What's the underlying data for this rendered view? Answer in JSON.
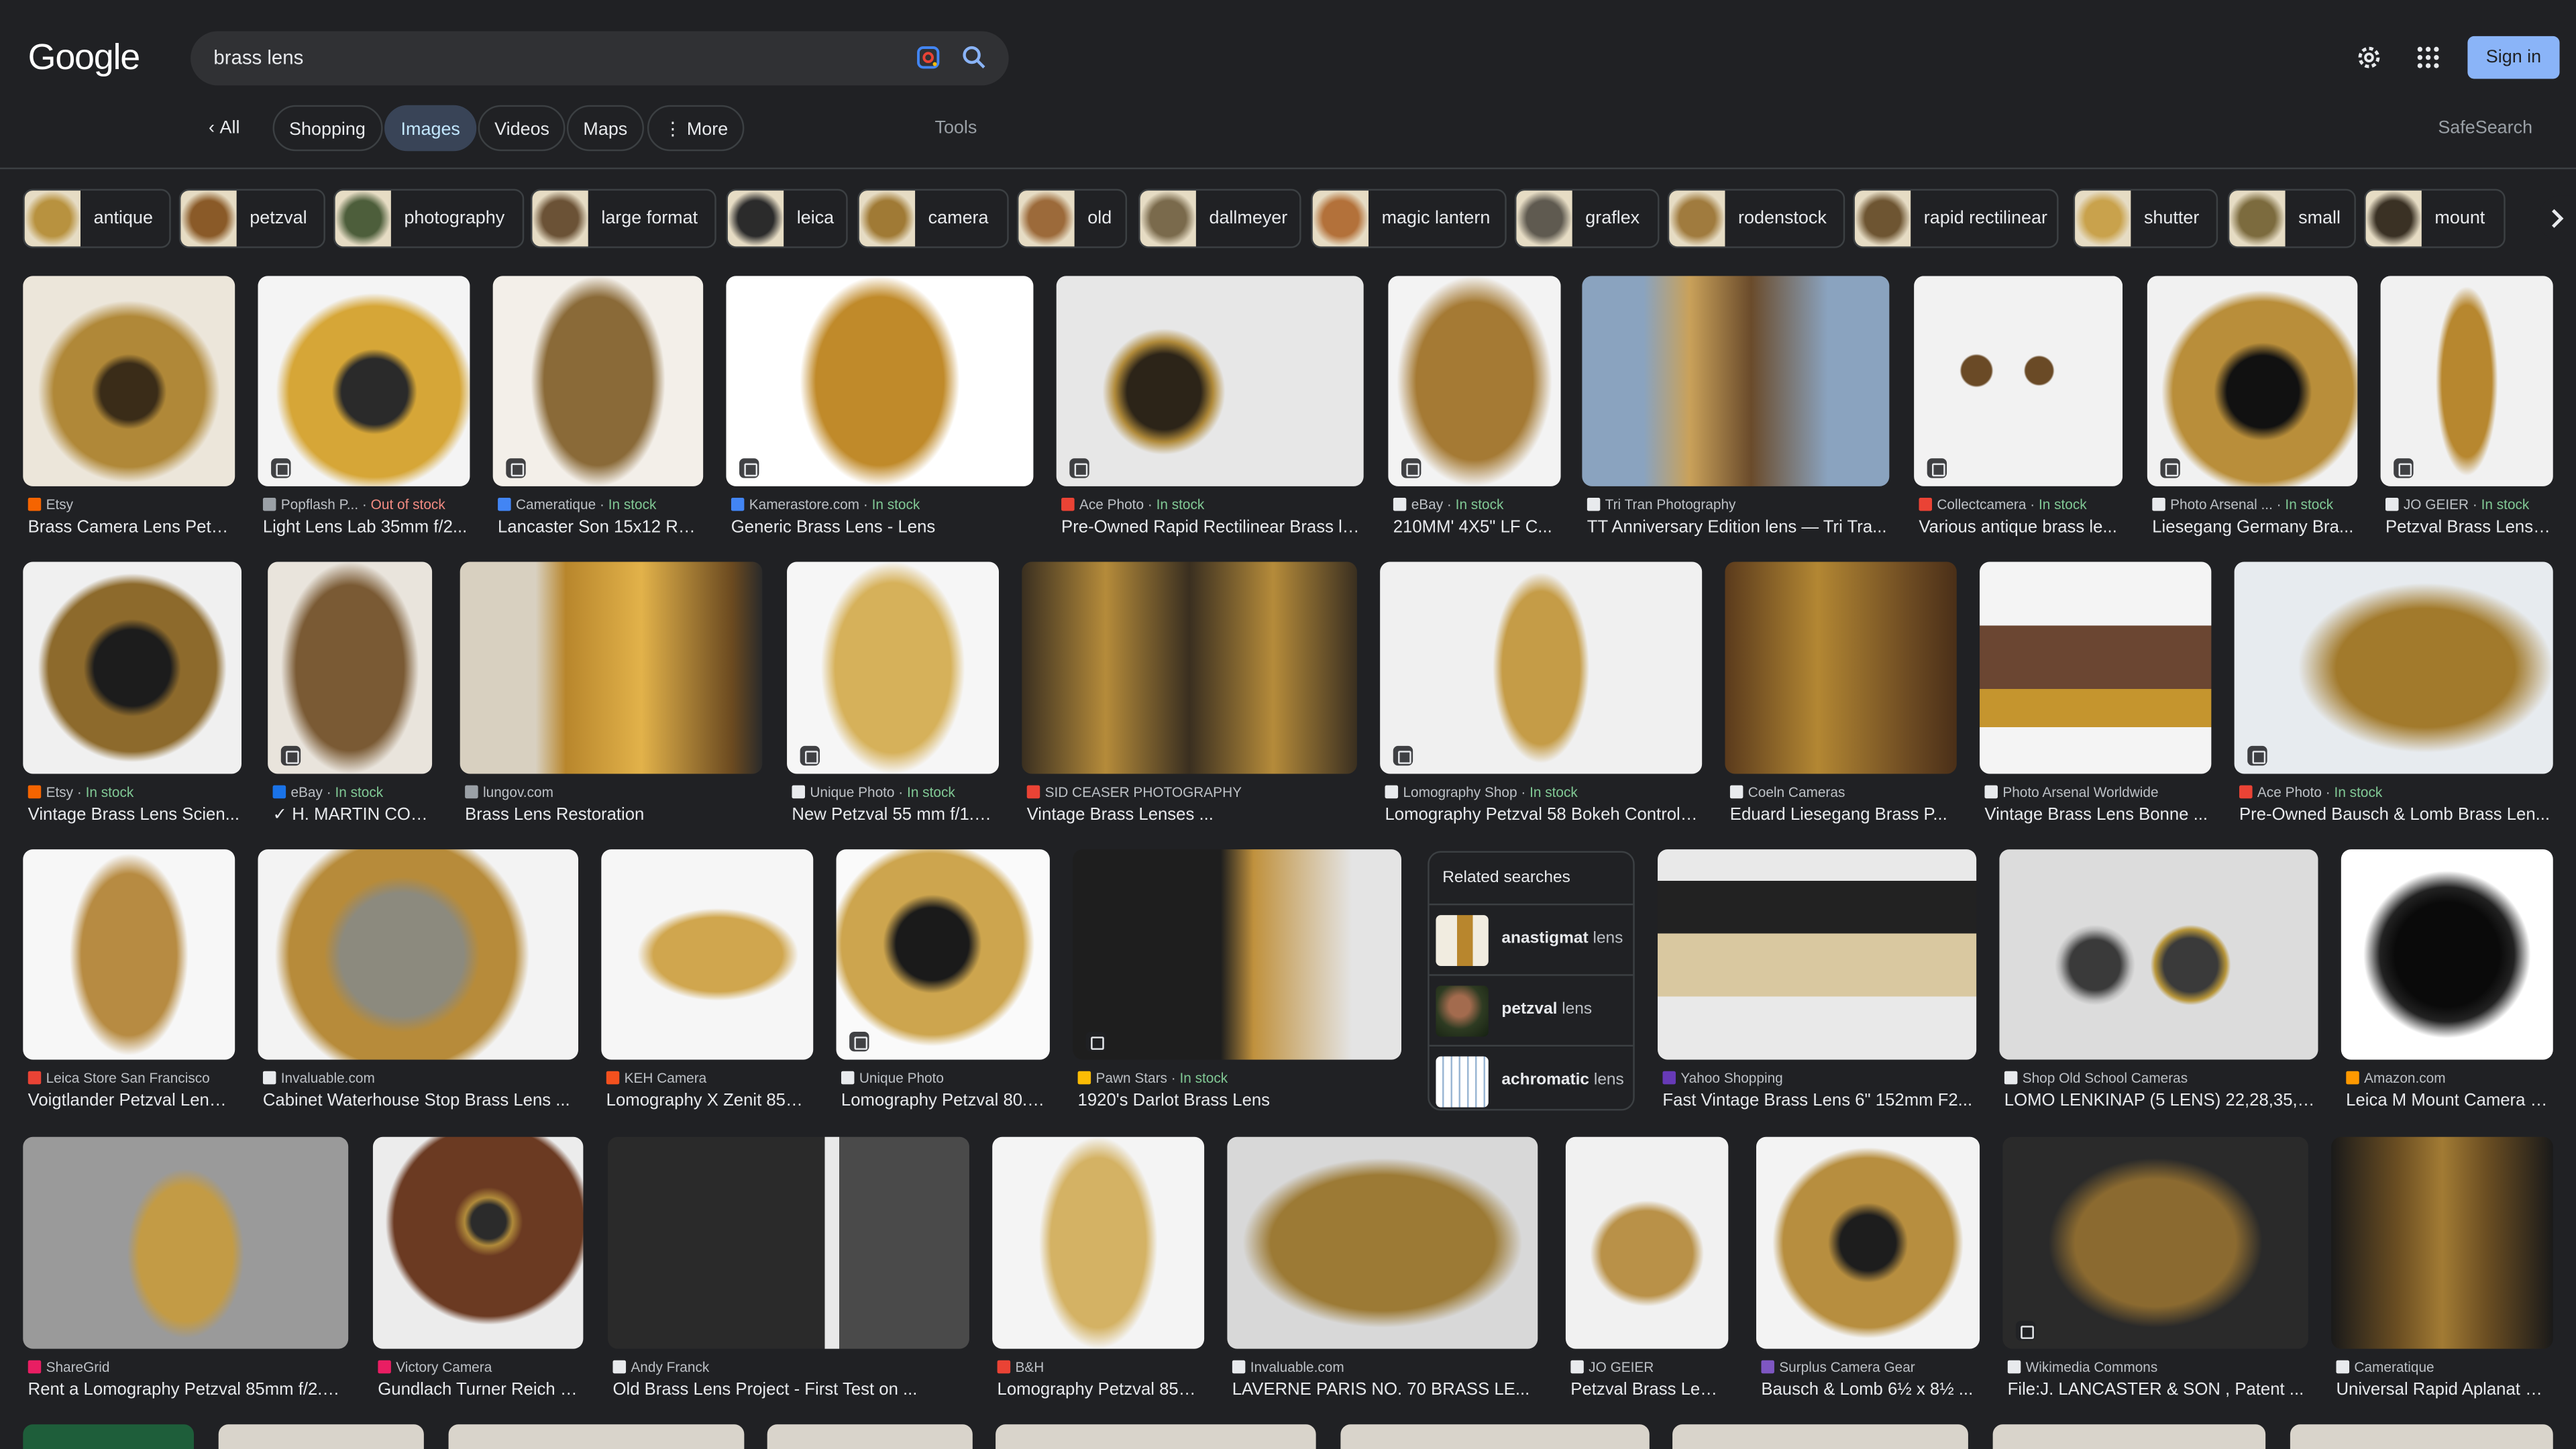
{
  "header": {
    "logo": "Google",
    "query": "brass lens",
    "sign_in": "Sign in"
  },
  "tabs": {
    "back": "All",
    "items": [
      "Shopping",
      "Images",
      "Videos",
      "Maps",
      "More"
    ],
    "active": "Images",
    "tools": "Tools",
    "safesearch": "SafeSearch"
  },
  "chips": [
    "antique",
    "petzval",
    "photography",
    "large format",
    "leica",
    "camera",
    "old",
    "dallmeyer",
    "magic lantern",
    "graflex",
    "rodenstock",
    "rapid rectilinear",
    "shutter",
    "small",
    "mount"
  ],
  "related": {
    "heading": "Related searches",
    "items": [
      {
        "bold": "anastigmat",
        "rest": "lens"
      },
      {
        "bold": "petzval",
        "rest": "lens"
      },
      {
        "bold": "achromatic",
        "rest": "lens"
      }
    ]
  },
  "results": [
    {
      "source": "Etsy",
      "stock": "",
      "title": "Brass Camera Lens Petz..."
    },
    {
      "source": "Popflash P...",
      "stock": "Out of stock",
      "title": "Light Lens Lab 35mm f/2..."
    },
    {
      "source": "Cameratique",
      "stock": "In stock",
      "title": "Lancaster Son 15x12 Re..."
    },
    {
      "source": "Kamerastore.com",
      "stock": "In stock",
      "title": "Generic Brass Lens - Lens"
    },
    {
      "source": "Ace Photo",
      "stock": "In stock",
      "title": "Pre-Owned Rapid Rectilinear Brass le..."
    },
    {
      "source": "eBay",
      "stock": "In stock",
      "title": "210MM' 4X5\" LF C..."
    },
    {
      "source": "Tri Tran Photography",
      "stock": "",
      "title": "TT Anniversary Edition lens — Tri Tra..."
    },
    {
      "source": "Collectcamera",
      "stock": "In stock",
      "title": "Various antique brass le..."
    },
    {
      "source": "Photo Arsenal ...",
      "stock": "In stock",
      "title": "Liesegang Germany Bra..."
    },
    {
      "source": "JO GEIER",
      "stock": "In stock",
      "title": "Petzval Brass Lens ..."
    },
    {
      "source": "Etsy",
      "stock": "In stock",
      "title": "Vintage Brass Lens Scien..."
    },
    {
      "source": "eBay",
      "stock": "In stock",
      "title": "✓ H. MARTIN CON..."
    },
    {
      "source": "lungov.com",
      "stock": "",
      "title": "Brass Lens Restoration"
    },
    {
      "source": "Unique Photo",
      "stock": "In stock",
      "title": "New Petzval 55 mm f/1.7..."
    },
    {
      "source": "SID CEASER PHOTOGRAPHY",
      "stock": "",
      "title": "Vintage Brass Lenses ..."
    },
    {
      "source": "Lomography Shop",
      "stock": "In stock",
      "title": "Lomography Petzval 58 Bokeh Control -..."
    },
    {
      "source": "Coeln Cameras",
      "stock": "",
      "title": "Eduard Liesegang Brass P..."
    },
    {
      "source": "Photo Arsenal Worldwide",
      "stock": "",
      "title": "Vintage Brass Lens Bonne ..."
    },
    {
      "source": "Ace Photo",
      "stock": "In stock",
      "title": "Pre-Owned Bausch & Lomb Brass Len..."
    },
    {
      "source": "Leica Store San Francisco",
      "stock": "",
      "title": "Voigtlander Petzval Lens ..."
    },
    {
      "source": "Invaluable.com",
      "stock": "",
      "title": "Cabinet Waterhouse Stop Brass Lens ..."
    },
    {
      "source": "KEH Camera",
      "stock": "",
      "title": "Lomography X Zenit 85m..."
    },
    {
      "source": "Unique Photo",
      "stock": "",
      "title": "Lomography Petzval 80.5..."
    },
    {
      "source": "Pawn Stars",
      "stock": "In stock",
      "title": "1920's Darlot Brass Lens"
    },
    {
      "source": "Yahoo Shopping",
      "stock": "",
      "title": "Fast Vintage Brass Lens 6\" 152mm F2..."
    },
    {
      "source": "Shop Old School Cameras",
      "stock": "",
      "title": "LOMO LENKINAP (5 LENS) 22,28,35,4..."
    },
    {
      "source": "Amazon.com",
      "stock": "",
      "title": "Leica M Mount Camera L..."
    },
    {
      "source": "ShareGrid",
      "stock": "",
      "title": "Rent a Lomography Petzval 85mm f/2.2 ..."
    },
    {
      "source": "Victory Camera",
      "stock": "",
      "title": "Gundlach Turner Reich 1..."
    },
    {
      "source": "Andy Franck",
      "stock": "",
      "title": "Old Brass Lens Project - First Test on ..."
    },
    {
      "source": "B&H",
      "stock": "",
      "title": "Lomography Petzval 85m..."
    },
    {
      "source": "Invaluable.com",
      "stock": "",
      "title": "LAVERNE PARIS NO. 70 BRASS LE..."
    },
    {
      "source": "JO GEIER",
      "stock": "",
      "title": "Petzval Brass Lens ..."
    },
    {
      "source": "Surplus Camera Gear",
      "stock": "",
      "title": "Bausch & Lomb 6½ x 8½ ..."
    },
    {
      "source": "Wikimedia Commons",
      "stock": "",
      "title": "File:J. LANCASTER & SON , Patent ..."
    },
    {
      "source": "Cameratique",
      "stock": "",
      "title": "Universal Rapid Aplanat C..."
    }
  ]
}
